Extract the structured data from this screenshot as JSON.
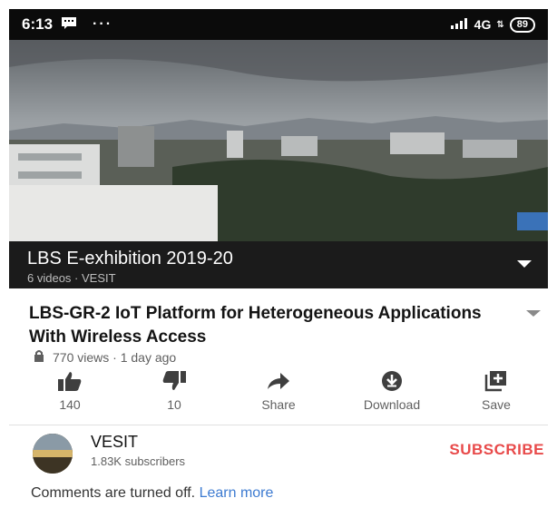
{
  "status_bar": {
    "time": "6:13",
    "more": "···",
    "network": "4G",
    "battery": "89"
  },
  "playlist": {
    "title": "LBS E-exhibition 2019-20",
    "subtitle": "6 videos · VESIT"
  },
  "video": {
    "title": "LBS-GR-2 IoT Platform for Heterogeneous Applications With Wireless Access",
    "stats": "770 views · 1 day ago"
  },
  "actions": {
    "like": "140",
    "dislike": "10",
    "share": "Share",
    "download": "Download",
    "save": "Save"
  },
  "channel": {
    "name": "VESIT",
    "subscribers": "1.83K subscribers",
    "subscribe": "SUBSCRIBE"
  },
  "comments": {
    "text": "Comments are turned off.",
    "link": "Learn more"
  },
  "colors": {
    "subscribe": "#e84a4a",
    "link": "#3d7bd1"
  }
}
